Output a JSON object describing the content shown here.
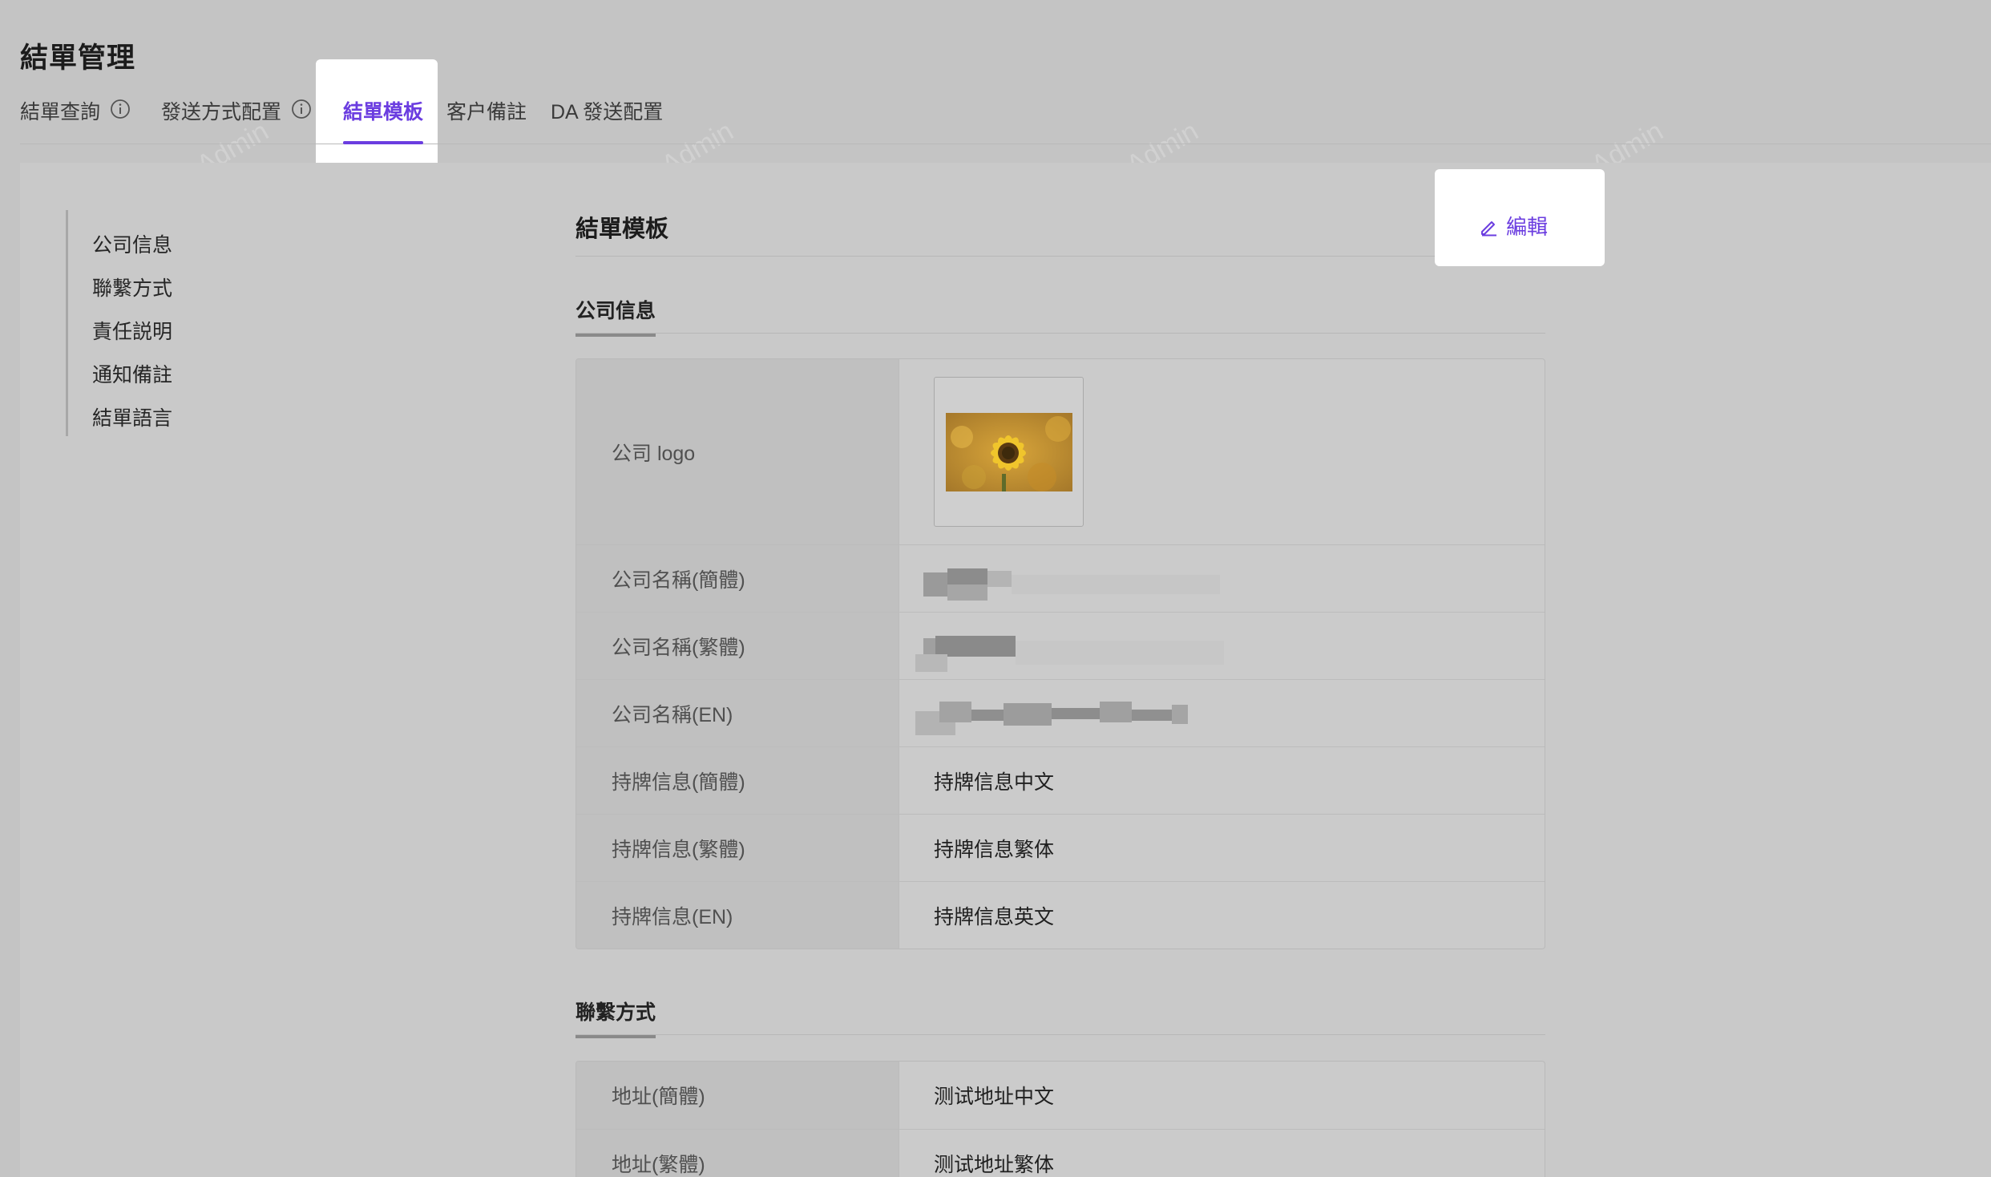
{
  "page": {
    "title": "結單管理"
  },
  "tabs": [
    {
      "label": "結單查詢",
      "has_info": true
    },
    {
      "label": "發送方式配置",
      "has_info": true
    },
    {
      "label": "結單模板",
      "active": true
    },
    {
      "label": "客户備註"
    },
    {
      "label": "DA 發送配置"
    }
  ],
  "anchor_nav": {
    "items": [
      "公司信息",
      "聯繫方式",
      "責任説明",
      "通知備註",
      "結單語言"
    ]
  },
  "main": {
    "title": "結單模板",
    "edit_label": "編輯",
    "company_section": {
      "title": "公司信息",
      "rows": [
        {
          "label": "公司 logo",
          "value": ""
        },
        {
          "label": "公司名稱(簡體)",
          "value": ""
        },
        {
          "label": "公司名稱(繁體)",
          "value": ""
        },
        {
          "label": "公司名稱(EN)",
          "value": ""
        },
        {
          "label": "持牌信息(簡體)",
          "value": "持牌信息中文"
        },
        {
          "label": "持牌信息(繁體)",
          "value": "持牌信息繁体"
        },
        {
          "label": "持牌信息(EN)",
          "value": "持牌信息英文"
        }
      ]
    },
    "contact_section": {
      "title": "聯繫方式",
      "rows": [
        {
          "label": "地址(簡體)",
          "value": "测试地址中文"
        },
        {
          "label": "地址(繁體)",
          "value": "测试地址繁体"
        }
      ]
    }
  },
  "watermark": {
    "text": "LongPort Test Admin"
  },
  "colors": {
    "accent": "#6b3de0",
    "background": "#c4c4c4"
  }
}
